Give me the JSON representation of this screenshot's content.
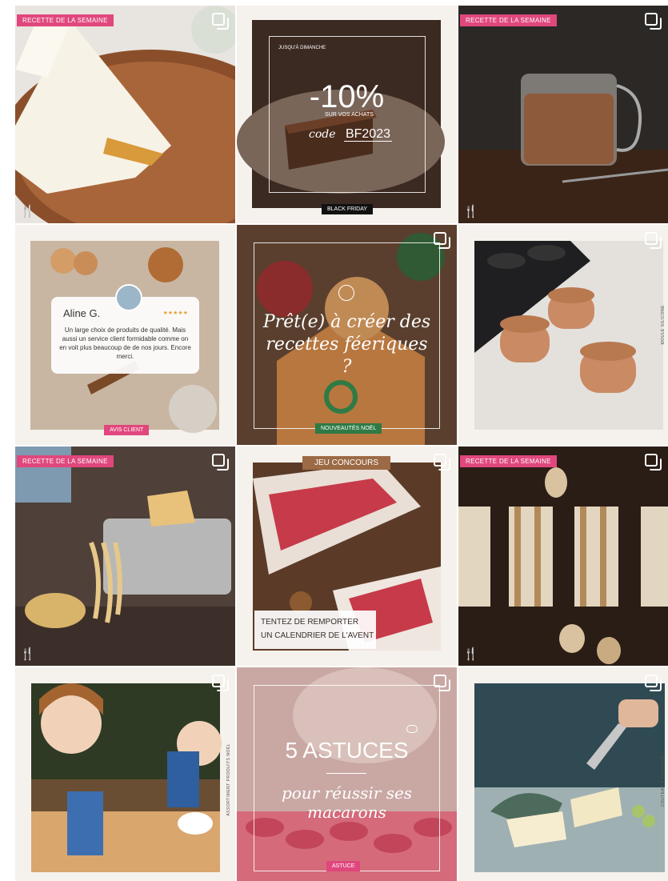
{
  "tiles": [
    {
      "id": "t1",
      "badge": "RECETTE DE LA SEMAINE",
      "icon": "utensils-icon"
    },
    {
      "id": "t2",
      "top": "JUSQU'À DIMANCHE",
      "big": "-10%",
      "sub": "SUR VOS ACHATS",
      "code_label": "code",
      "code": "BF2023",
      "tag": "BLACK FRIDAY"
    },
    {
      "id": "t3",
      "badge": "RECETTE DE LA SEMAINE",
      "icon": "utensils-icon"
    },
    {
      "id": "t4",
      "name": "Aline G.",
      "stars": "★★★★★",
      "review": "Un large choix de produits de qualité. Mais aussi un service client formidable comme on en voit plus beaucoup de de nos jours. Encore merci.",
      "tag": "AVIS CLIENT"
    },
    {
      "id": "t5",
      "headline": "Prêt(e) à créer des recettes féeriques ?",
      "tag": "NOUVEAUTÉS NOËL",
      "icon": "santa-icon"
    },
    {
      "id": "t6",
      "vtext": "MOULE SILICONE"
    },
    {
      "id": "t7",
      "badge": "RECETTE DE LA SEMAINE",
      "icon": "utensils-icon"
    },
    {
      "id": "t8",
      "tag": "JEU CONCOURS",
      "line1": "TENTEZ DE REMPORTER",
      "line2": "UN CALENDRIER DE L'AVENT"
    },
    {
      "id": "t9",
      "badge": "RECETTE DE LA SEMAINE",
      "icon": "utensils-icon"
    },
    {
      "id": "t10",
      "vtext": "ASSORTIMENT PRODUITS NOËL"
    },
    {
      "id": "t11",
      "title": "5 ASTUCES",
      "sub": "pour réussir ses macarons",
      "tag": "ASTUCE",
      "icon": "macaron-icon"
    },
    {
      "id": "t12",
      "vtext": "COUTEAU À FROMAGE"
    }
  ],
  "colors": {
    "pink": "#e0477d",
    "green": "#2f7a45",
    "brown": "#8c5a3c"
  }
}
